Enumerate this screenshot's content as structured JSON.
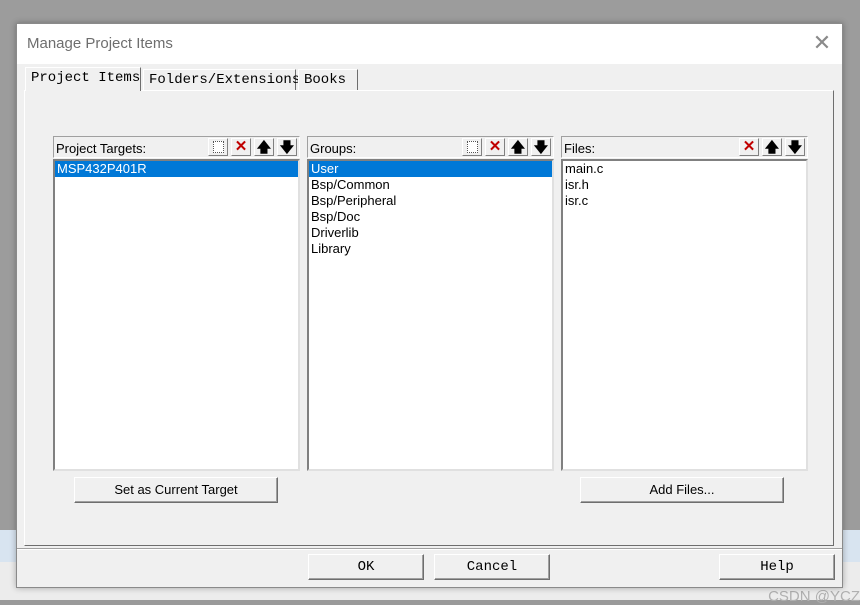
{
  "window": {
    "title": "Manage Project Items",
    "close_label": "✕"
  },
  "tabs": [
    {
      "label": "Project Items"
    },
    {
      "label": "Folders/Extensions"
    },
    {
      "label": "Books"
    }
  ],
  "panes": {
    "targets": {
      "label": "Project Targets:",
      "items": [
        "MSP432P401R"
      ],
      "selected": 0,
      "button": "Set as Current Target"
    },
    "groups": {
      "label": "Groups:",
      "items": [
        "User",
        "Bsp/Common",
        "Bsp/Peripheral",
        "Bsp/Doc",
        "Driverlib",
        "Library"
      ],
      "selected": 0
    },
    "files": {
      "label": "Files:",
      "items": [
        "main.c",
        "isr.h",
        "isr.c"
      ],
      "button": "Add Files..."
    }
  },
  "tool_icons": {
    "new": "new-item-icon",
    "delete": "delete-icon",
    "up": "move-up-icon",
    "down": "move-down-icon",
    "up_glyph": "🡅",
    "down_glyph": "🡇",
    "delete_glyph": "✕"
  },
  "footer": {
    "ok": "OK",
    "cancel": "Cancel",
    "help": "Help"
  },
  "watermark": "CSDN @YCZ",
  "colors": {
    "selection": "#0078d7",
    "delete_icon": "#c00000",
    "dialog_bg": "#f0f0f0"
  }
}
